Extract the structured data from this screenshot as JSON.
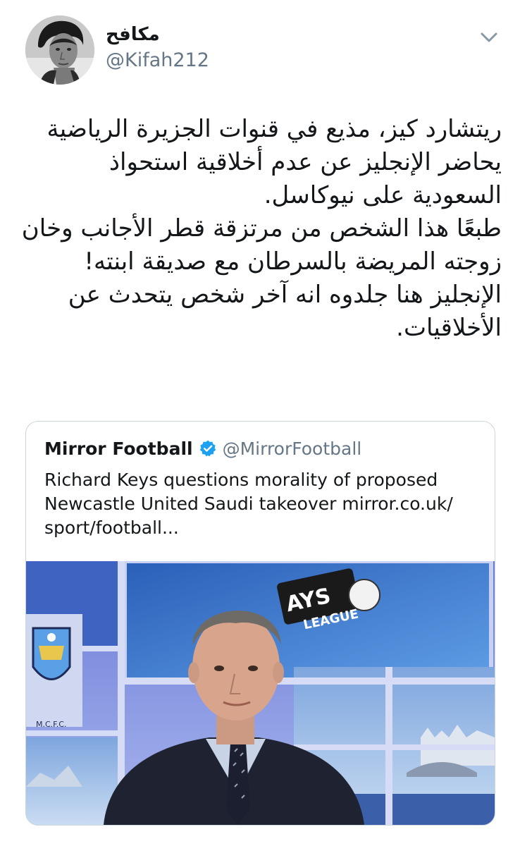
{
  "author": {
    "display_name": "مكافح",
    "handle": "@Kifah212"
  },
  "tweet": {
    "lines": [
      "ريتشارد كيز، مذيع في قنوات الجزيرة الرياضية",
      "يحاضر الإنجليز عن عدم أخلاقية استحواذ",
      "السعودية على نيوكاسل.",
      "طبعًا هذا الشخص من مرتزقة قطر الأجانب وخان",
      "زوجته المريضة بالسرطان مع صديقة ابنته!",
      "الإنجليز هنا جلدوه انه آخر شخص يتحدث عن",
      "الأخلاقيات."
    ]
  },
  "quoted": {
    "name": "Mirror Football",
    "handle": "@MirrorFootball",
    "text_lines": [
      "Richard Keys questions morality of proposed",
      "Newcastle United Saudi takeover mirror.co.uk/",
      "sport/football..."
    ],
    "image": {
      "board_text_1": "AYS",
      "board_text_2": "LEAGUE",
      "crest_text": "M.C.F.C."
    }
  },
  "icons": {
    "chevron": "chevron-down-icon",
    "verified": "verified-badge-icon"
  },
  "colors": {
    "text": "#14171a",
    "secondary": "#657786",
    "border": "#ccd6dd",
    "verified": "#1da1f2"
  }
}
